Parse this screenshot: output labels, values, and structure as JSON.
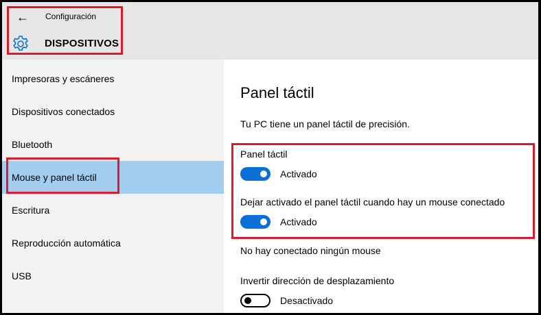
{
  "header": {
    "app_title": "Configuración",
    "section_title": "DISPOSITIVOS",
    "back_icon": "arrow-left-icon",
    "section_icon": "gear-icon",
    "accent_color": "#0a6fd6"
  },
  "sidebar": {
    "items": [
      {
        "label": "Impresoras y escáneres"
      },
      {
        "label": "Dispositivos conectados"
      },
      {
        "label": "Bluetooth"
      },
      {
        "label": "Mouse y panel táctil",
        "active": true
      },
      {
        "label": "Escritura"
      },
      {
        "label": "Reproducción automática"
      },
      {
        "label": "USB"
      }
    ],
    "active_color": "#a3cdef"
  },
  "main": {
    "title": "Panel táctil",
    "description": "Tu PC tiene un panel táctil de precisión.",
    "settings": [
      {
        "label": "Panel táctil",
        "state": "Activado",
        "on": true
      },
      {
        "label": "Dejar activado el panel táctil cuando hay un mouse conectado",
        "state": "Activado",
        "on": true
      },
      {
        "label": "No hay conectado ningún mouse"
      },
      {
        "label": "Invertir dirección de desplazamiento",
        "state": "Desactivado",
        "on": false
      }
    ]
  },
  "annotation_color": "#e1172a"
}
